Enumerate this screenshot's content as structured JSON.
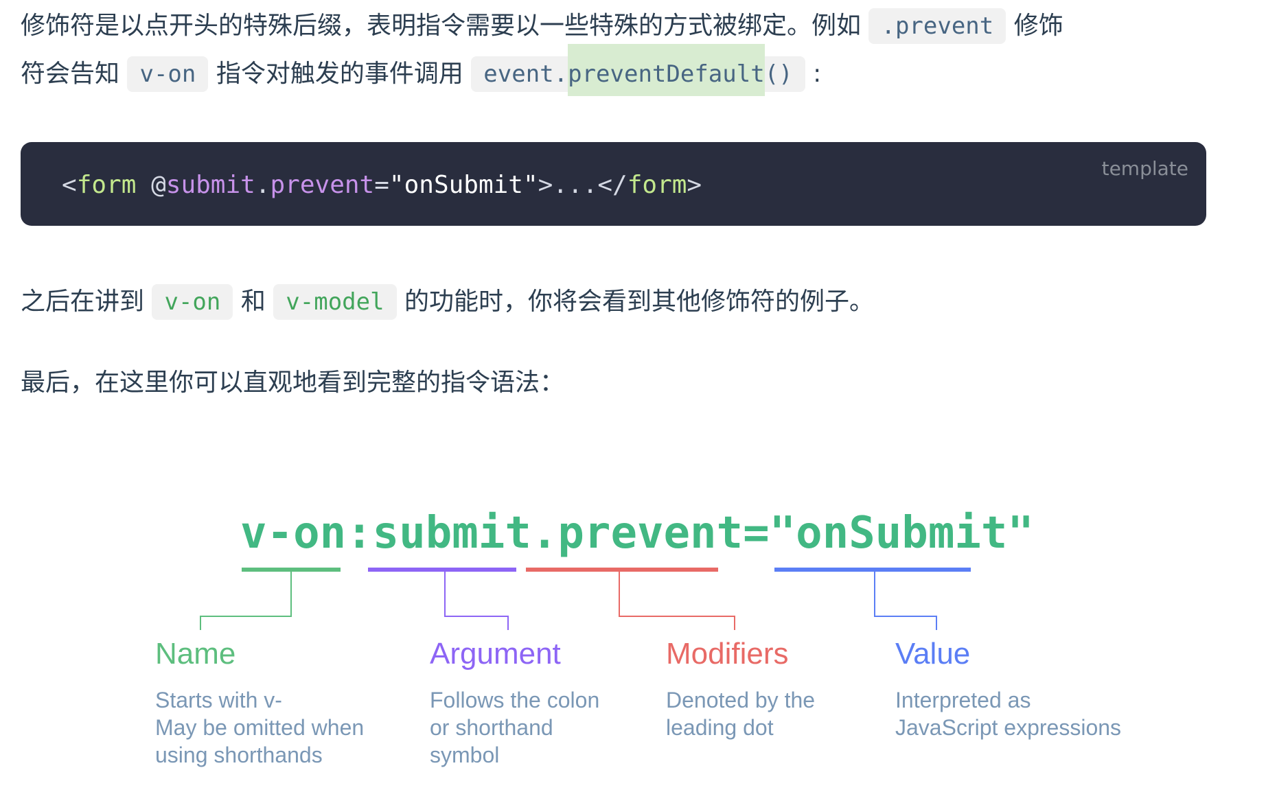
{
  "para1": {
    "line1_text": "修饰符是以点开头的特殊后缀，表明指令需要以一些特殊的方式被绑定。例如",
    "line1_code": ".prevent",
    "line1_tail": "修饰",
    "line2_head": "符会告知",
    "line2_code1": "v-on",
    "line2_mid": "指令对触发的事件调用",
    "line2_code2_a": "event.",
    "line2_code2_b": "preventDefault",
    "line2_code2_c": "()",
    "line2_tail": ":"
  },
  "codeblock": {
    "lang": "template",
    "tokens": {
      "lt": "<",
      "form1": "form",
      "space": " ",
      "at": "@",
      "submit": "submit",
      "dot": ".",
      "prevent": "prevent",
      "eq": "=",
      "q1": "\"",
      "val": "onSubmit",
      "q2": "\"",
      "gt": ">...</",
      "form2": "form",
      "end": ">"
    }
  },
  "para2": {
    "head": "之后在讲到",
    "code1": "v-on",
    "and": "和",
    "code2": "v-model",
    "tail": "的功能时，你将会看到其他修饰符的例子。"
  },
  "para3": {
    "text": "最后，在这里你可以直观地看到完整的指令语法："
  },
  "diagram": {
    "syntax": "v-on:submit.prevent=\"onSubmit\"",
    "colors": {
      "name": "#5dbe7e",
      "argument": "#8d65f5",
      "modifiers": "#e86a66",
      "value": "#5b7ef5"
    },
    "parts": [
      {
        "title": "Name",
        "lines": [
          "Starts with v-",
          "May be omitted when",
          "using shorthands"
        ]
      },
      {
        "title": "Argument",
        "lines": [
          "Follows the colon",
          "or shorthand",
          "symbol"
        ]
      },
      {
        "title": "Modifiers",
        "lines": [
          "Denoted by the",
          "leading dot"
        ]
      },
      {
        "title": "Value",
        "lines": [
          "Interpreted as",
          "JavaScript expressions"
        ]
      }
    ]
  }
}
